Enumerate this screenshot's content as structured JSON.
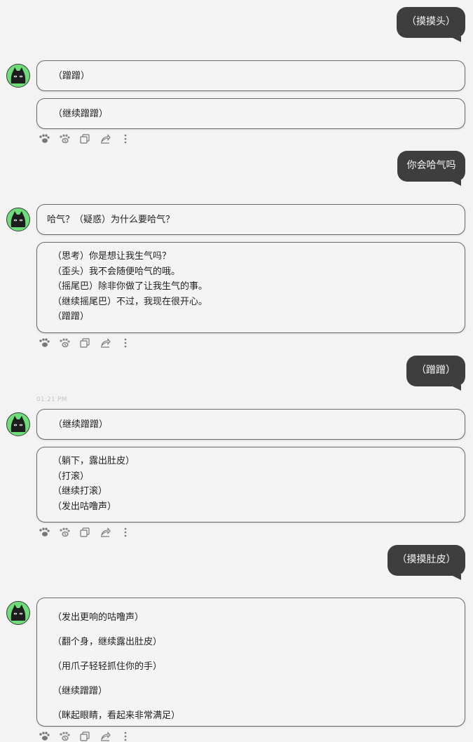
{
  "colors": {
    "background": "#f3f3f3",
    "user_bubble": "#3e3e3e",
    "bot_border": "#6a6a6a",
    "avatar_bg": "#6ddc79"
  },
  "icons": [
    "paw-icon",
    "paw-outline-icon",
    "copy-icon",
    "share-icon",
    "more-icon"
  ],
  "messages": [
    {
      "role": "user",
      "text": "（摸摸头）"
    },
    {
      "role": "assistant",
      "bubbles": [
        [
          "（蹭蹭）"
        ],
        [
          "（继续蹭蹭）"
        ]
      ]
    },
    {
      "role": "user",
      "text": "你会哈气吗"
    },
    {
      "role": "assistant",
      "bubbles": [
        [
          "哈气？（疑惑）为什么要哈气？"
        ],
        [
          "（思考）你是想让我生气吗？",
          "（歪头）我不会随便哈气的哦。",
          "（摇尾巴）除非你做了让我生气的事。",
          "（继续摇尾巴）不过，我现在很开心。",
          "（蹭蹭）"
        ]
      ]
    },
    {
      "role": "user",
      "text": "（蹭蹭）"
    },
    {
      "role": "assistant",
      "timestamp": "01:21 PM",
      "bubbles": [
        [
          "（继续蹭蹭）"
        ],
        [
          "（躺下，露出肚皮）",
          "（打滚）",
          "（继续打滚）",
          "（发出咕噜声）"
        ]
      ]
    },
    {
      "role": "user",
      "text": "（摸摸肚皮）"
    },
    {
      "role": "assistant",
      "bubbles": [
        [
          "（发出更响的咕噜声）",
          "（翻个身，继续露出肚皮）",
          "（用爪子轻轻抓住你的手）",
          "（继续蹭蹭）",
          "（眯起眼睛，看起来非常满足）"
        ]
      ]
    }
  ]
}
